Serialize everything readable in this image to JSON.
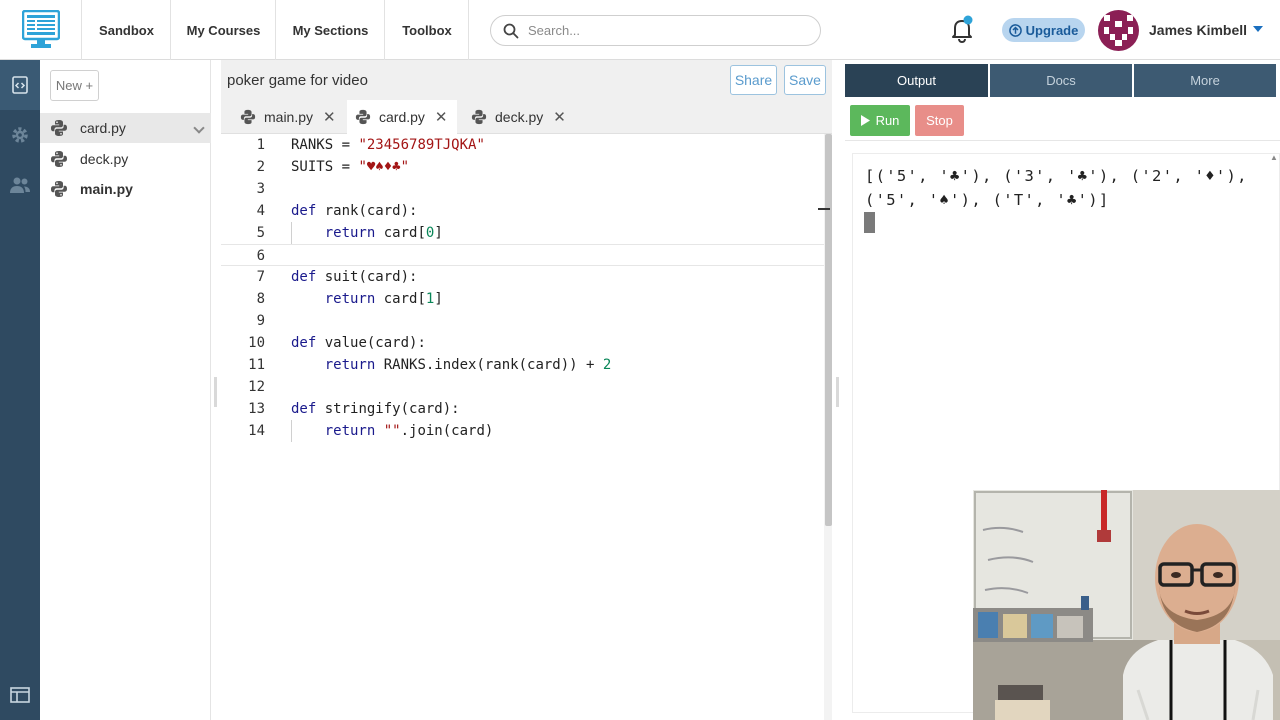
{
  "nav": {
    "items": [
      {
        "label": "Sandbox"
      },
      {
        "label": "My Courses"
      },
      {
        "label": "My Sections"
      },
      {
        "label": "Toolbox"
      }
    ],
    "search_placeholder": "Search...",
    "upgrade_label": "Upgrade",
    "user_name": "James Kimbell"
  },
  "files": {
    "new_label": "New +",
    "items": [
      {
        "name": "card.py"
      },
      {
        "name": "deck.py"
      },
      {
        "name": "main.py"
      }
    ]
  },
  "editor": {
    "project_title": "poker game for video",
    "share_label": "Share",
    "save_label": "Save",
    "tabs": [
      {
        "label": "main.py"
      },
      {
        "label": "card.py"
      },
      {
        "label": "deck.py"
      }
    ],
    "lines": [
      {
        "num": "1",
        "text": "RANKS = \"23456789TJQKA\""
      },
      {
        "num": "2",
        "text": "SUITS = \"♥♠♦♣\""
      },
      {
        "num": "3",
        "text": ""
      },
      {
        "num": "4",
        "text": "def rank(card):"
      },
      {
        "num": "5",
        "text": "    return card[0]"
      },
      {
        "num": "6",
        "text": ""
      },
      {
        "num": "7",
        "text": "def suit(card):"
      },
      {
        "num": "8",
        "text": "    return card[1]"
      },
      {
        "num": "9",
        "text": ""
      },
      {
        "num": "10",
        "text": "def value(card):"
      },
      {
        "num": "11",
        "text": "    return RANKS.index(rank(card)) + 2"
      },
      {
        "num": "12",
        "text": ""
      },
      {
        "num": "13",
        "text": "def stringify(card):"
      },
      {
        "num": "14",
        "text": "    return \"\".join(card)"
      }
    ]
  },
  "output": {
    "tabs": [
      {
        "label": "Output"
      },
      {
        "label": "Docs"
      },
      {
        "label": "More"
      }
    ],
    "run_label": "Run",
    "stop_label": "Stop",
    "console_text": "[('5', '♣'), ('3', '♣'), ('2', '♦'), ('5', '♠'), ('T', '♣')]"
  },
  "colors": {
    "rail": "#2f4a61",
    "output_tab_active": "#2a4255",
    "output_tab": "#3d5a72",
    "run": "#5cb85c",
    "stop": "#e88e89",
    "upgrade_bg": "#b8d5ef"
  }
}
